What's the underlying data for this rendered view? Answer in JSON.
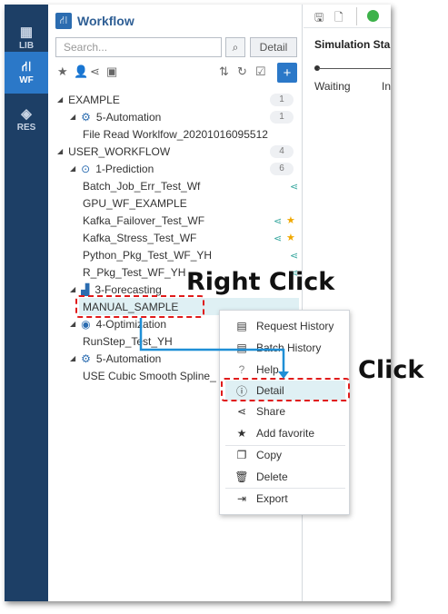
{
  "rail": {
    "items": [
      {
        "label": "LIB",
        "icon": "library-icon"
      },
      {
        "label": "WF",
        "icon": "workflow-icon"
      },
      {
        "label": "RES",
        "icon": "layers-icon"
      }
    ]
  },
  "panel": {
    "title": "Workflow",
    "search_placeholder": "Search...",
    "detail_label": "Detail",
    "add_label": "+"
  },
  "tree": [
    {
      "label": "EXAMPLE",
      "count": "1"
    },
    {
      "label": "5-Automation",
      "count": "1"
    },
    {
      "label": "File Read Worklfow_20201016095512"
    },
    {
      "label": "USER_WORKFLOW",
      "count": "4"
    },
    {
      "label": "1-Prediction",
      "count": "6"
    },
    {
      "label": "Batch_Job_Err_Test_Wf"
    },
    {
      "label": "GPU_WF_EXAMPLE"
    },
    {
      "label": "Kafka_Failover_Test_WF"
    },
    {
      "label": "Kafka_Stress_Test_WF"
    },
    {
      "label": "Python_Pkg_Test_WF_YH"
    },
    {
      "label": "R_Pkg_Test_WF_YH"
    },
    {
      "label": "3-Forecasting"
    },
    {
      "label": "MANUAL_SAMPLE"
    },
    {
      "label": "4-Optimization"
    },
    {
      "label": "RunStep_Test_YH"
    },
    {
      "label": "5-Automation"
    },
    {
      "label": "USE Cubic Smooth Spline_"
    }
  ],
  "sim": {
    "title": "Simulation Sta",
    "waiting": "Waiting",
    "in": "In"
  },
  "menu": {
    "items": [
      {
        "label": "Request History",
        "icon": "history-icon"
      },
      {
        "label": "Batch History",
        "icon": "batch-icon"
      },
      {
        "label": "Help",
        "icon": "help-icon"
      },
      {
        "label": "Detail",
        "icon": "info-icon"
      },
      {
        "label": "Share",
        "icon": "share-icon"
      },
      {
        "label": "Add favorite",
        "icon": "star-icon"
      },
      {
        "label": "Copy",
        "icon": "copy-icon"
      },
      {
        "label": "Delete",
        "icon": "trash-icon"
      },
      {
        "label": "Export",
        "icon": "export-icon"
      }
    ]
  },
  "annotations": {
    "right_click": "Right Click",
    "click": "Click"
  },
  "colors": {
    "rail_bg": "#1d3f66",
    "rail_active": "#2b78c8",
    "highlight": "#dff0f4",
    "annotation_red": "#e01b1b",
    "arrow_blue": "#1f8fd6",
    "share_teal": "#3aa8a0",
    "star_gold": "#f0a800"
  }
}
